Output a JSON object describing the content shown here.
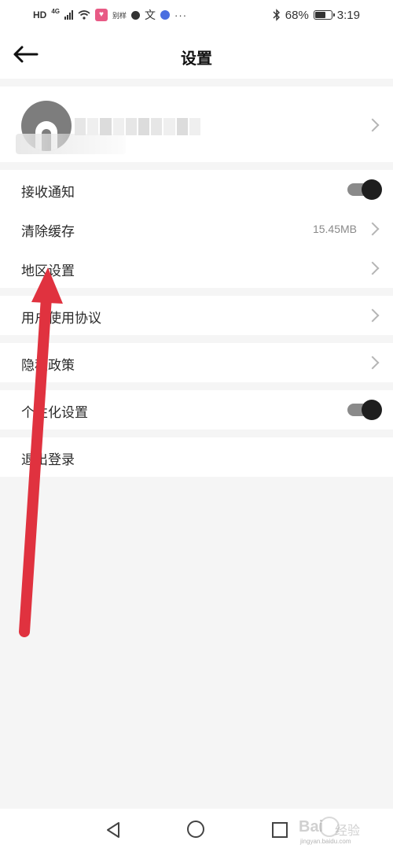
{
  "status_bar": {
    "hd": "HD",
    "network": "4G",
    "small_app_tag": "别样",
    "wen_glyph": "文",
    "more": "···",
    "battery_percent": "68%",
    "battery_level": 0.68,
    "time": "3:19"
  },
  "header": {
    "title": "设置",
    "back_icon": "arrow-left-icon"
  },
  "profile": {
    "avatar_icon": "default-avatar-icon",
    "name_redacted": true
  },
  "settings": {
    "receive_notifications": {
      "label": "接收通知",
      "enabled": true
    },
    "clear_cache": {
      "label": "清除缓存",
      "value": "15.45MB"
    },
    "region_settings": {
      "label": "地区设置"
    },
    "user_agreement": {
      "label": "用户使用协议"
    },
    "privacy_policy": {
      "label": "隐私政策"
    },
    "personalization": {
      "label": "个性化设置",
      "enabled": true
    },
    "logout": {
      "label": "退出登录"
    }
  },
  "navigation": {
    "back_icon": "triangle-back-icon",
    "home_icon": "circle-home-icon",
    "recent_icon": "square-recent-icon"
  },
  "watermark": {
    "text": "Bai",
    "text2": "经验",
    "sub": "jingyan.baidu.com"
  },
  "colors": {
    "annotation_arrow": "#e0323f",
    "toggle_knob": "#1e1e1e",
    "background": "#f5f5f5"
  }
}
